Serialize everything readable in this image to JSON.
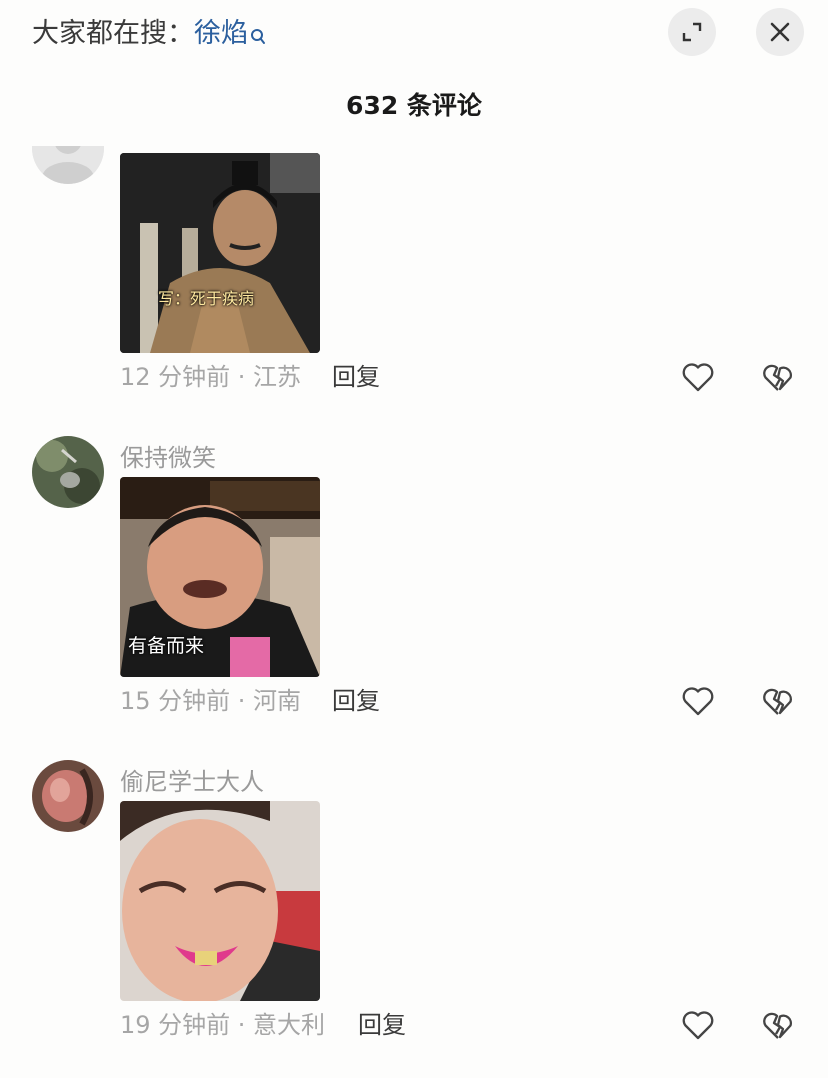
{
  "header": {
    "search_prefix": "大家都在搜：",
    "search_term": "徐焰",
    "expand_button": "expand-icon",
    "close_button": "close-icon"
  },
  "comment_count_label": "632 条评论",
  "comments": [
    {
      "username": "",
      "avatar": "default-avatar",
      "image_caption": "写：死于疾病",
      "time_location": "12 分钟前 · 江苏",
      "reply_label": "回复"
    },
    {
      "username": "保持微笑",
      "avatar": "photo-avatar",
      "image_caption": "有备而来",
      "time_location": "15 分钟前 · 河南",
      "reply_label": "回复"
    },
    {
      "username": "偷尼学士大人",
      "avatar": "photo-avatar",
      "image_caption": "",
      "time_location": "19 分钟前 · 意大利",
      "reply_label": "回复"
    }
  ],
  "icons": {
    "like": "heart-icon",
    "dislike": "broken-heart-icon",
    "search": "search-icon"
  }
}
